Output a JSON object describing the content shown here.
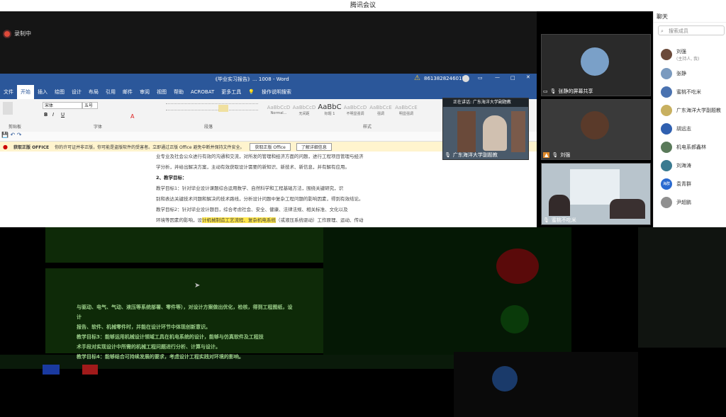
{
  "app": {
    "title": "腾讯会议"
  },
  "recording": {
    "label": "录制中"
  },
  "word": {
    "title": "《毕业实习报告》... 1008 - Word",
    "account": "8613828246017",
    "warning_icon": "warning-icon",
    "menu": [
      "文件",
      "开始",
      "插入",
      "绘图",
      "设计",
      "布局",
      "引用",
      "邮件",
      "审阅",
      "视图",
      "帮助",
      "ACROBAT",
      "更多工具"
    ],
    "menu_active": 1,
    "tell_me": "操作说明搜索",
    "font_name": "宋体",
    "font_size": "五号",
    "groups": [
      "剪贴板",
      "字体",
      "段落",
      "样式"
    ],
    "styles": [
      {
        "preview": "AaBbCcD",
        "name": "Normal..."
      },
      {
        "preview": "AaBbCcD",
        "name": "无间距"
      },
      {
        "preview": "AaBbC",
        "name": "标题 1"
      },
      {
        "preview": "AaBbCcD",
        "name": "不明显强调"
      },
      {
        "preview": "AaBbCcE",
        "name": "强调"
      },
      {
        "preview": "AaBbCcE",
        "name": "明显强调"
      }
    ],
    "infobar": {
      "title": "获取正版 OFFICE",
      "message": "你的许可证并非正版，你可能是盗版软件的受害者。立即通过正版 Office 避免中断并保持文件安全。",
      "btn1": "获取正版 Office",
      "btn2": "了解详细信息"
    },
    "doc": {
      "line1": "业专业及社会公众进行有效的沟通和交流，对所发的管理和经济方面的问题，进行工程项目管理与经济",
      "line2": "学分析，并给出解决方案，主动有效获取设计需要的新知识、新技术、新信息，并有解有应用。",
      "heading": "2、教学目标：",
      "line3": "教学目标1：针对毕业设计课题综合运用数学、自然科学和工程基础方法，围绕关键研究，识",
      "line4": "别和表达关键技术问题和解决的技术路线，分析设计问题中复杂工程问题的影响因素，得到有效结论。",
      "line5": "教学目标2：针对毕业设计题目，综合考虑社会、安全、健康、法律法规、相关标准、文化以及",
      "line6a": "环境等因素的影响，设",
      "line6hl": "计机械制造工艺流程、复杂机电系统",
      "line6b": "（或液压系统驱动）工作原理、运动、传动"
    }
  },
  "presenter": {
    "label": "正在讲话: 广东海洋大学副题教",
    "name": "广东海洋大学副题教"
  },
  "videos": [
    {
      "name": "张静的屏幕共享"
    },
    {
      "name": "刘强"
    },
    {
      "name": "蜜桃不吃米"
    }
  ],
  "chat": {
    "title": "聊天",
    "search_placeholder": "搜索成员",
    "members": [
      {
        "name": "刘强",
        "sub": "(主持人, 我)",
        "color": "#6b4a3a"
      },
      {
        "name": "张静",
        "sub": "",
        "color": "#7a9abf"
      },
      {
        "name": "蜜桃不吃米",
        "sub": "",
        "color": "#4a72b0"
      },
      {
        "name": "广东海洋大学副题教",
        "sub": "",
        "color": "#c8b060"
      },
      {
        "name": "胡远志",
        "sub": "",
        "color": "#3060b0"
      },
      {
        "name": "机电系郝鑫林",
        "sub": "",
        "color": "#5a7a5a"
      },
      {
        "name": "刘海涛",
        "sub": "",
        "color": "#3a7a90"
      },
      {
        "name": "袁青群",
        "sub": "",
        "color": "#2a6ad0",
        "badge": "海群"
      },
      {
        "name": "尹超鹏",
        "sub": "",
        "color": "#909090"
      }
    ]
  },
  "glitch": {
    "para1": "与驱动、电气、气动、液压等系统部署、零件等），对设计方案做出优化，检核，得到工程图纸，设计",
    "para2": "报告、软件、机械零件时，并能在设计环节中体现创新意识。",
    "para3": "教学目标3：能够运用机械设计领域工具在机电系统的设计，能够与仿真软件及工程技",
    "para4": "术手段对实现设计中所需的机械工程问题进行分析、计算与设计。",
    "para5": "教学目标4：能够结合可持续发展的要求，考虑设计工程实践对环境的影响。"
  }
}
